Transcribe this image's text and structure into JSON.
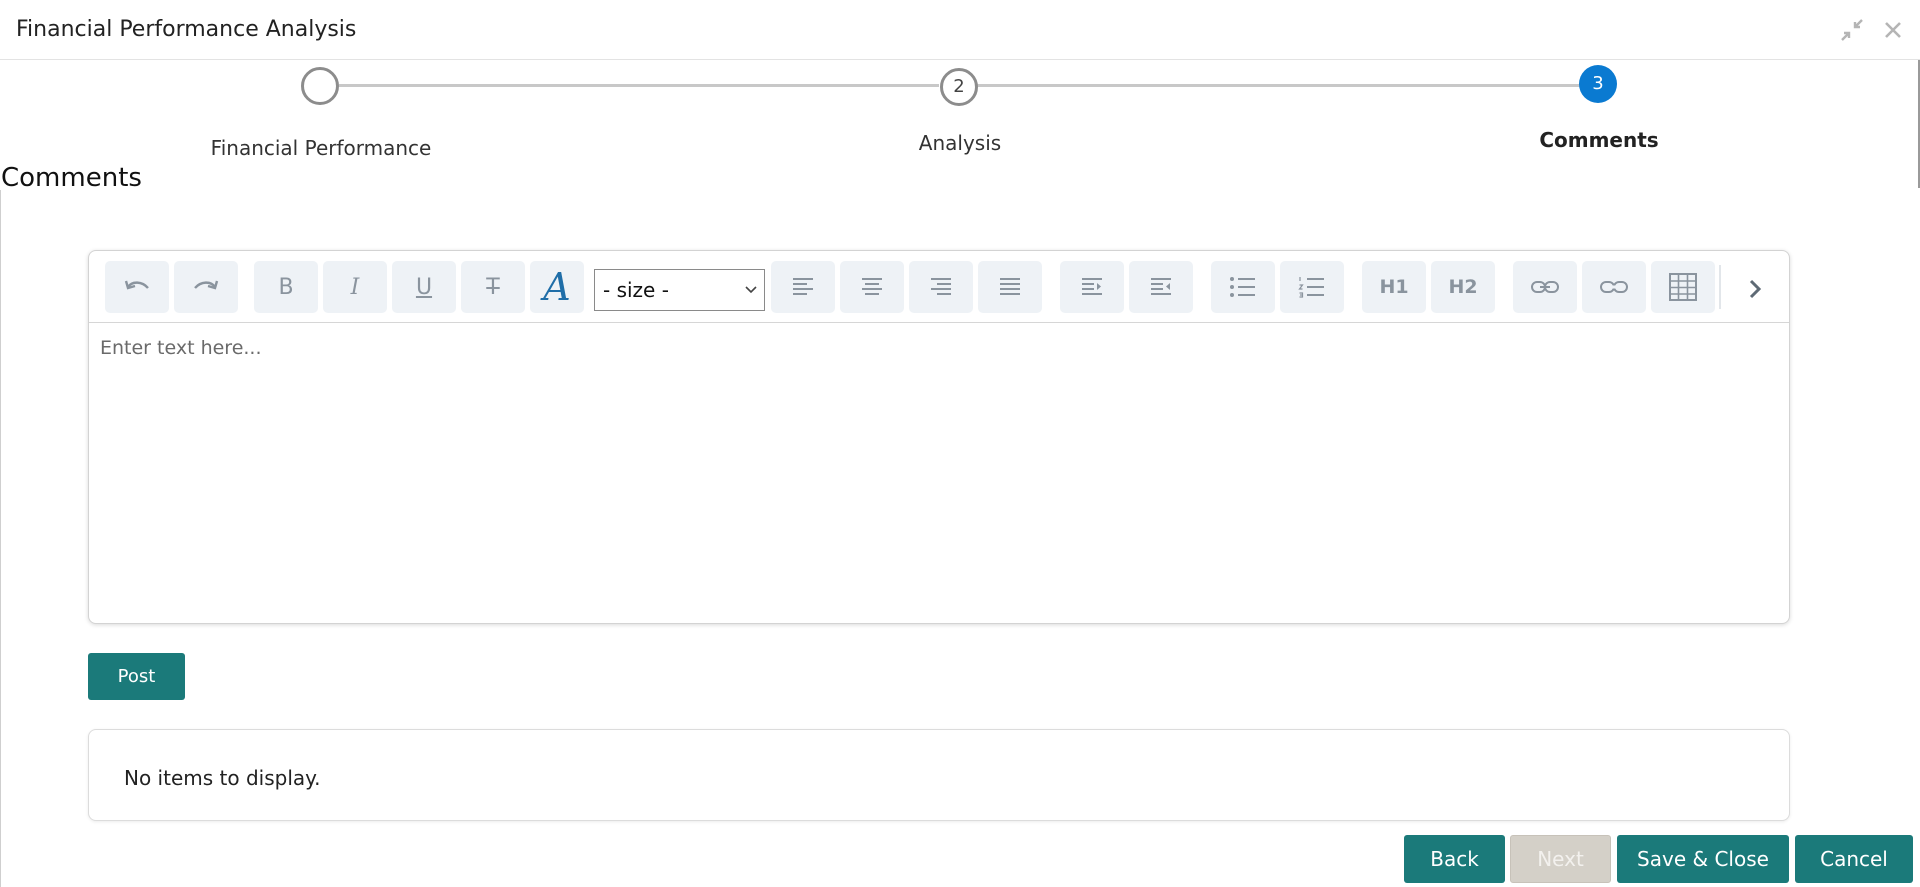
{
  "window": {
    "title": "Financial Performance Analysis"
  },
  "icons": {
    "minimize": "collapse-arrows-icon",
    "close": "close-icon"
  },
  "stepper": {
    "steps": [
      {
        "number": "",
        "label": "Financial Performance",
        "state": "completed"
      },
      {
        "number": "2",
        "label": "Analysis",
        "state": "pending"
      },
      {
        "number": "3",
        "label": "Comments",
        "state": "active"
      }
    ]
  },
  "section": {
    "title": "Comments"
  },
  "editor": {
    "toolbar": {
      "undo": "undo-icon",
      "redo": "redo-icon",
      "bold": "B",
      "italic": "I",
      "underline": "U",
      "strikethrough": "T",
      "font_color": "A",
      "size_select": "- size -",
      "h1": "H1",
      "h2": "H2"
    },
    "placeholder": "Enter text here..."
  },
  "post_button": "Post",
  "items": {
    "empty_text": "No items to display."
  },
  "footer": {
    "back": "Back",
    "next": "Next",
    "save_close": "Save & Close",
    "cancel": "Cancel"
  },
  "colors": {
    "accent": "#1b7a7a",
    "active_step": "#0a7ad1",
    "disabled_button": "#d4d0c8"
  }
}
